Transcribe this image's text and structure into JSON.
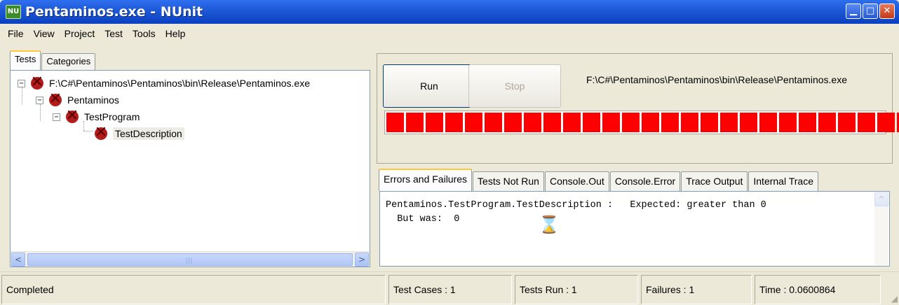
{
  "window": {
    "title": "Pentaminos.exe - NUnit",
    "icon_label": "NU",
    "buttons": {
      "minimize": "▁",
      "maximize": "□",
      "close": "✕"
    }
  },
  "menu": [
    "File",
    "View",
    "Project",
    "Test",
    "Tools",
    "Help"
  ],
  "left_tabs": [
    "Tests",
    "Categories"
  ],
  "tree": {
    "root": "F:\\C#\\Pentaminos\\Pentaminos\\bin\\Release\\Pentaminos.exe",
    "namespace": "Pentaminos",
    "fixture": "TestProgram",
    "test": "TestDescription",
    "expander_symbol": "−"
  },
  "buttons": {
    "run": "Run",
    "stop": "Stop"
  },
  "test_path": "F:\\C#\\Pentaminos\\Pentaminos\\bin\\Release\\Pentaminos.exe",
  "progress": {
    "fraction": 1.0,
    "color": "#ff0000"
  },
  "result_tabs": [
    "Errors and Failures",
    "Tests Not Run",
    "Console.Out",
    "Console.Error",
    "Trace Output",
    "Internal Trace"
  ],
  "output": {
    "line1": "Pentaminos.TestProgram.TestDescription :   Expected: greater than 0",
    "line2": "  But was:  0"
  },
  "status": {
    "message": "Completed",
    "test_cases": "Test Cases : 1",
    "tests_run": "Tests Run : 1",
    "failures": "Failures : 1",
    "time": "Time : 0.0600864"
  },
  "icons": {
    "hourglass": "⌛",
    "scroll_left": "<",
    "scroll_right": ">",
    "scroll_up": "^",
    "grip": "|||",
    "resize": "◢"
  }
}
